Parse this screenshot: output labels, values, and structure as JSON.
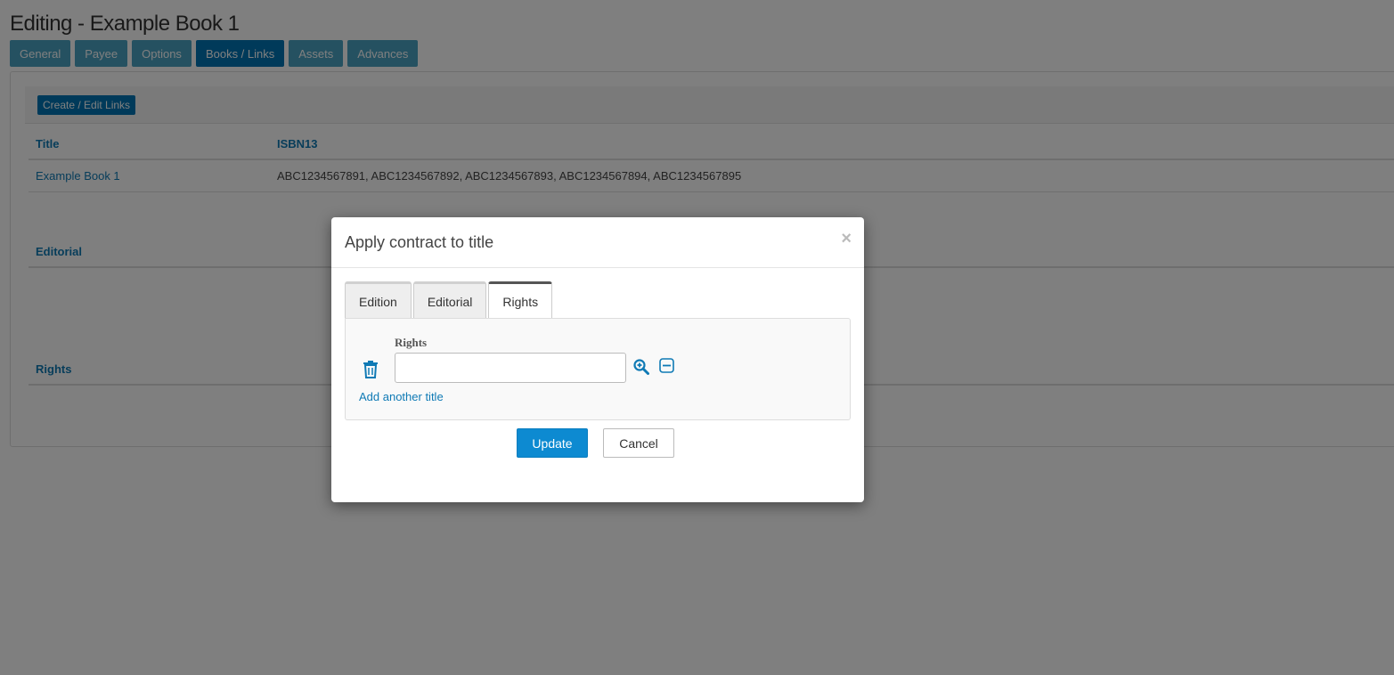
{
  "page": {
    "title": "Editing - Example Book 1",
    "tabs": [
      {
        "label": "General"
      },
      {
        "label": "Payee"
      },
      {
        "label": "Options"
      },
      {
        "label": "Books / Links"
      },
      {
        "label": "Assets"
      },
      {
        "label": "Advances"
      }
    ],
    "active_tab": "Books / Links",
    "create_button": "Create / Edit Links",
    "table": {
      "headers": [
        "Title",
        "ISBN13"
      ],
      "rows": [
        {
          "title": "Example Book 1",
          "isbn13": "ABC1234567891, ABC1234567892, ABC1234567893, ABC1234567894, ABC1234567895"
        }
      ]
    },
    "sections": [
      "Editorial",
      "Rights"
    ]
  },
  "modal": {
    "title": "Apply contract to title",
    "close_symbol": "×",
    "tabs": [
      {
        "label": "Edition"
      },
      {
        "label": "Editorial"
      },
      {
        "label": "Rights"
      }
    ],
    "active_tab": "Rights",
    "field_label": "Rights",
    "field_value": "",
    "add_link": "Add another title",
    "update_button": "Update",
    "cancel_button": "Cancel",
    "icons": [
      "trash-icon",
      "zoom-in-icon",
      "minus-square-icon"
    ]
  },
  "colors": {
    "primary": "#0074b4",
    "tab": "#4ba3c3",
    "link": "#0f7ab5",
    "update": "#0d8ad1"
  }
}
